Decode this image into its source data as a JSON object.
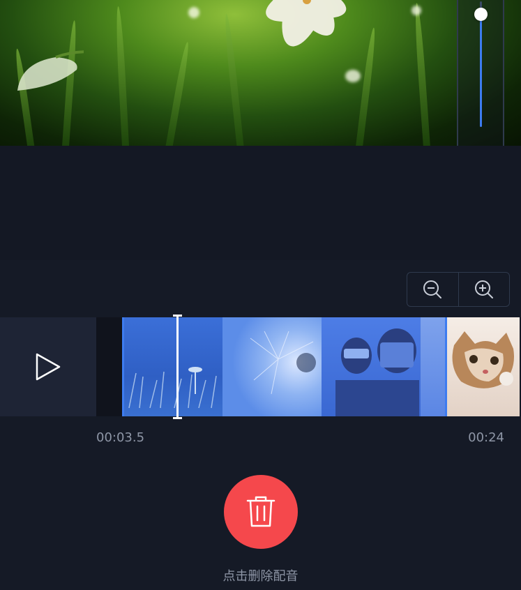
{
  "timeline": {
    "current_time": "00:03.5",
    "end_time": "00:24"
  },
  "delete": {
    "caption": "点击删除配音"
  },
  "volume": {
    "level": 0.9
  },
  "icons": {
    "play": "play-icon",
    "zoom_out": "zoom-out-icon",
    "zoom_in": "zoom-in-icon",
    "speaker": "speaker-icon",
    "trash": "trash-icon"
  },
  "colors": {
    "accent": "#3d7cf0",
    "delete": "#f5484c",
    "background": "#141824"
  }
}
